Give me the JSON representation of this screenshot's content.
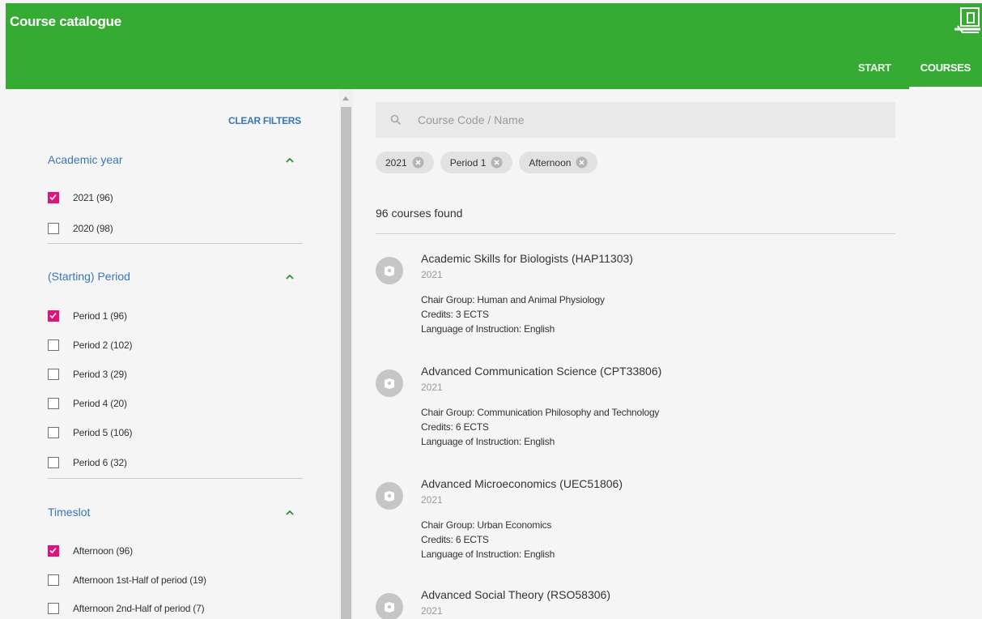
{
  "header": {
    "title": "Course catalogue",
    "nav": [
      {
        "label": "START"
      },
      {
        "label": "COURSES"
      }
    ],
    "brand_color": "#35ab34"
  },
  "sidebar": {
    "clear_filters": "CLEAR FILTERS",
    "groups": [
      {
        "title": "Academic year",
        "options": [
          {
            "label": "2021 (96)",
            "checked": true
          },
          {
            "label": "2020 (98)",
            "checked": false
          }
        ]
      },
      {
        "title": "(Starting) Period",
        "options": [
          {
            "label": "Period 1 (96)",
            "checked": true
          },
          {
            "label": "Period 2 (102)",
            "checked": false
          },
          {
            "label": "Period 3 (29)",
            "checked": false
          },
          {
            "label": "Period 4 (20)",
            "checked": false
          },
          {
            "label": "Period 5 (106)",
            "checked": false
          },
          {
            "label": "Period 6 (32)",
            "checked": false
          }
        ]
      },
      {
        "title": "Timeslot",
        "options": [
          {
            "label": "Afternoon (96)",
            "checked": true
          },
          {
            "label": "Afternoon 1st-Half of period (19)",
            "checked": false
          },
          {
            "label": "Afternoon 2nd-Half of period (7)",
            "checked": false
          }
        ]
      }
    ],
    "check_color": "#e1127c"
  },
  "search": {
    "placeholder": "Course Code / Name",
    "value": ""
  },
  "active_filters": [
    {
      "label": "2021"
    },
    {
      "label": "Period 1"
    },
    {
      "label": "Afternoon"
    }
  ],
  "results": {
    "count_text": "96 courses found",
    "courses": [
      {
        "title": "Academic Skills for Biologists (HAP11303)",
        "year": "2021",
        "chair_group": "Chair Group: Human and Animal Physiology",
        "credits": "Credits: 3 ECTS",
        "language": "Language of Instruction: English"
      },
      {
        "title": "Advanced Communication Science (CPT33806)",
        "year": "2021",
        "chair_group": "Chair Group: Communication Philosophy and Technology",
        "credits": "Credits: 6 ECTS",
        "language": "Language of Instruction: English"
      },
      {
        "title": "Advanced Microeconomics (UEC51806)",
        "year": "2021",
        "chair_group": "Chair Group: Urban Economics",
        "credits": "Credits: 6 ECTS",
        "language": "Language of Instruction: English"
      },
      {
        "title": "Advanced Social Theory (RSO58306)",
        "year": "2021"
      }
    ]
  }
}
